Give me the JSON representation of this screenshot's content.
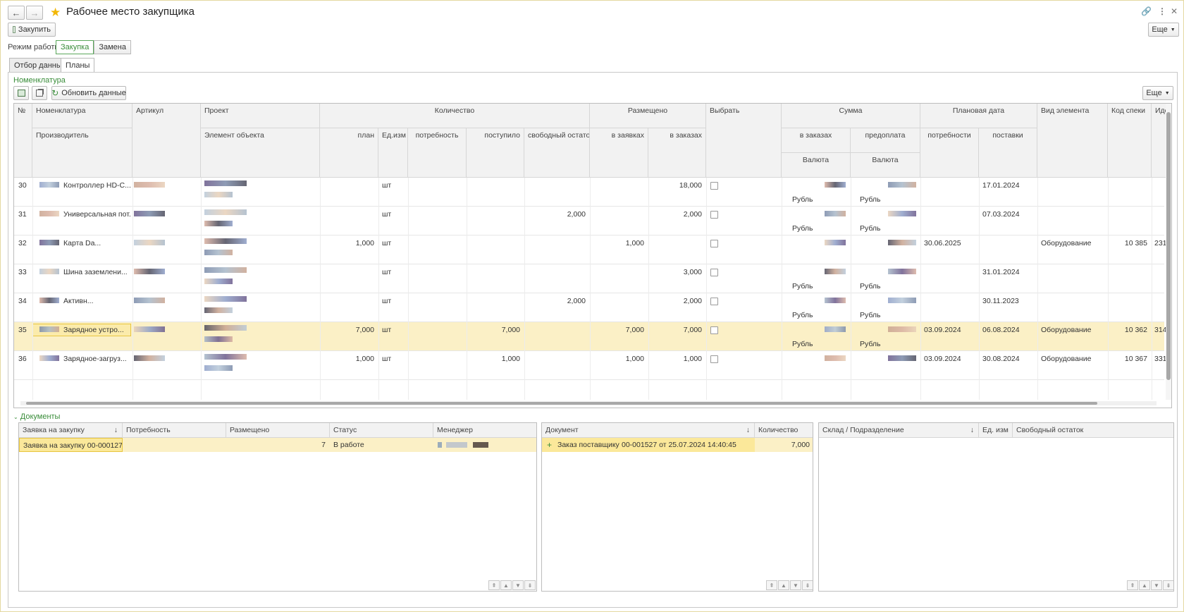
{
  "window": {
    "title": "Рабочее место закупщика",
    "back_icon": "←",
    "forward_icon": "→",
    "more_label": "Еще"
  },
  "toolbar": {
    "buy_label": "Закупить"
  },
  "mode": {
    "label": "Режим работы:",
    "options": [
      "Закупка",
      "Замена"
    ],
    "selected": "Закупка"
  },
  "tabs": [
    "Отбор данных",
    "Планы"
  ],
  "nomenclature": {
    "title": "Номенклатура",
    "refresh_label": "Обновить данные",
    "more_label": "Еще",
    "headers": {
      "num": "№",
      "nom": "Номенклатура",
      "producer": "Производитель",
      "article": "Артикул",
      "project": "Проект",
      "object_element": "Элемент объекта",
      "quantity": "Количество",
      "plan": "план",
      "unit": "Ед.изм",
      "need": "потребность",
      "received": "поступило",
      "free": "свободный остаток",
      "placed": "Размещено",
      "in_requests": "в заявках",
      "in_orders": "в заказах",
      "choose": "Выбрать",
      "sum": "Сумма",
      "sum_orders": "в заказах",
      "prepay": "предоплата",
      "currency1": "Валюта",
      "currency2": "Валюта",
      "plan_date": "Плановая дата",
      "date_need": "потребности",
      "date_supply": "поставки",
      "element_type": "Вид элемента",
      "spec_code": "Код спеки",
      "id": "Иде"
    },
    "rows": [
      {
        "n": "30",
        "name": "Контроллер HD-C...",
        "plan": "",
        "unit": "шт",
        "need": "",
        "received": "",
        "free": "",
        "in_req": "",
        "in_ord": "18,000",
        "cur1": "Рубль",
        "cur2": "Рубль",
        "date_need": "",
        "date_sup": "17.01.2024",
        "type": "",
        "code": "",
        "id": ""
      },
      {
        "n": "31",
        "name": "Универсальная пот...",
        "plan": "",
        "unit": "шт",
        "need": "",
        "received": "",
        "free": "2,000",
        "in_req": "",
        "in_ord": "2,000",
        "cur1": "Рубль",
        "cur2": "Рубль",
        "date_need": "",
        "date_sup": "07.03.2024",
        "type": "",
        "code": "",
        "id": ""
      },
      {
        "n": "32",
        "name": "Карта Da...",
        "plan": "1,000",
        "unit": "шт",
        "need": "",
        "received": "",
        "free": "",
        "in_req": "1,000",
        "in_ord": "",
        "cur1": "",
        "cur2": "",
        "date_need": "30.06.2025",
        "date_sup": "",
        "type": "Оборудование",
        "code": "10 385",
        "id": "231"
      },
      {
        "n": "33",
        "name": "Шина заземлени...",
        "plan": "",
        "unit": "шт",
        "need": "",
        "received": "",
        "free": "",
        "in_req": "",
        "in_ord": "3,000",
        "cur1": "Рубль",
        "cur2": "Рубль",
        "date_need": "",
        "date_sup": "31.01.2024",
        "type": "",
        "code": "",
        "id": ""
      },
      {
        "n": "34",
        "name": "Активн...",
        "plan": "",
        "unit": "шт",
        "need": "",
        "received": "",
        "free": "2,000",
        "in_req": "",
        "in_ord": "2,000",
        "cur1": "Рубль",
        "cur2": "Рубль",
        "date_need": "",
        "date_sup": "30.11.2023",
        "type": "",
        "code": "",
        "id": ""
      },
      {
        "n": "35",
        "name": "Зарядное устро...",
        "plan": "7,000",
        "unit": "шт",
        "need": "",
        "received": "7,000",
        "free": "",
        "in_req": "7,000",
        "in_ord": "7,000",
        "cur1": "Рубль",
        "cur2": "Рубль",
        "date_need": "03.09.2024",
        "date_sup": "06.08.2024",
        "type": "Оборудование",
        "code": "10 362",
        "id": "314"
      },
      {
        "n": "36",
        "name": "Зарядное-загруз...",
        "plan": "1,000",
        "unit": "шт",
        "need": "",
        "received": "1,000",
        "free": "",
        "in_req": "1,000",
        "in_ord": "1,000",
        "cur1": "",
        "cur2": "",
        "date_need": "03.09.2024",
        "date_sup": "30.08.2024",
        "type": "Оборудование",
        "code": "10 367",
        "id": "331"
      }
    ]
  },
  "documents": {
    "title": "Документы",
    "requests": {
      "headers": [
        "Заявка на закупку",
        "Потребность",
        "Размещено",
        "Статус",
        "Менеджер"
      ],
      "rows": [
        {
          "request": "Заявка на закупку 00-000127 ...",
          "need": "",
          "placed": "7",
          "status": "В работе"
        }
      ]
    },
    "orders": {
      "headers": [
        "Документ",
        "Количество"
      ],
      "rows": [
        {
          "doc": "Заказ поставщику",
          "doc_num": "00-001527 от 25.07.2024 14:40:45",
          "qty": "7,000"
        }
      ]
    },
    "stock": {
      "headers": [
        "Склад / Подразделение",
        "Ед. изм",
        "Свободный остаток"
      ]
    }
  },
  "colors": {
    "accent_green": "#3a8d3a",
    "selection": "#fbf0c6",
    "star": "#f2b705"
  }
}
